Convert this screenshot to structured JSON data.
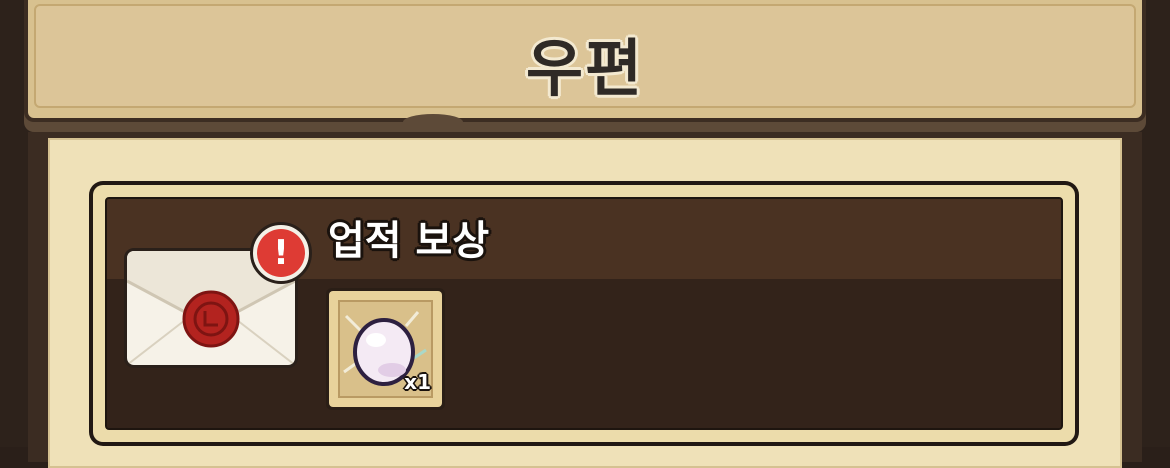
{
  "header": {
    "title": "우편"
  },
  "mail": {
    "title": "업적 보상",
    "alert_symbol": "!",
    "icon": "envelope-wax-seal-icon",
    "reward": {
      "icon": "white-egg-icon",
      "quantity": "x1"
    }
  },
  "colors": {
    "header_bg": "#d8c18f",
    "panel_bg": "#efe1b8",
    "card_bg": "#33231a",
    "alert_red": "#de3b34",
    "seal_red": "#b3231f"
  }
}
